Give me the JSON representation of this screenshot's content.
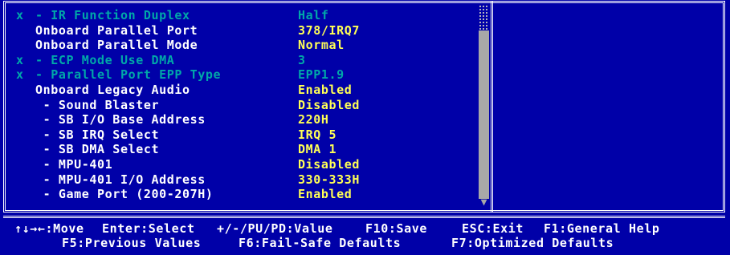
{
  "menu_rows": [
    {
      "marker": "x",
      "label": "- IR Function Duplex",
      "value": "Half",
      "disabled": true
    },
    {
      "marker": "",
      "label": "Onboard Parallel Port",
      "value": "378/IRQ7",
      "disabled": false
    },
    {
      "marker": "",
      "label": "Onboard Parallel Mode",
      "value": "Normal",
      "disabled": false
    },
    {
      "marker": "x",
      "label": "- ECP Mode Use DMA",
      "value": "3",
      "disabled": true
    },
    {
      "marker": "x",
      "label": "- Parallel Port EPP Type",
      "value": "EPP1.9",
      "disabled": true
    },
    {
      "marker": "",
      "label": "Onboard Legacy Audio",
      "value": "Enabled",
      "disabled": false
    },
    {
      "marker": "",
      "label": " - Sound Blaster",
      "value": "Disabled",
      "disabled": false
    },
    {
      "marker": "",
      "label": " - SB I/O Base Address",
      "value": "220H",
      "disabled": false
    },
    {
      "marker": "",
      "label": " - SB IRQ Select",
      "value": "IRQ 5",
      "disabled": false
    },
    {
      "marker": "",
      "label": " - SB DMA Select",
      "value": "DMA 1",
      "disabled": false
    },
    {
      "marker": "",
      "label": " - MPU-401",
      "value": "Disabled",
      "disabled": false
    },
    {
      "marker": "",
      "label": " - MPU-401 I/O Address",
      "value": "330-333H",
      "disabled": false
    },
    {
      "marker": "",
      "label": " - Game Port (200-207H)",
      "value": "Enabled",
      "disabled": false
    }
  ],
  "scrollbar": {
    "down_arrow": "▼"
  },
  "footer": {
    "line1": [
      "↑↓→←:Move",
      "Enter:Select",
      "+/-/PU/PD:Value",
      "F10:Save",
      "ESC:Exit",
      "F1:General Help"
    ],
    "line2": [
      "F5:Previous Values",
      "F6:Fail-Safe Defaults",
      "F7:Optimized Defaults"
    ]
  },
  "colors": {
    "background": "#0000a8",
    "label": "#ffffff",
    "value": "#ffff55",
    "disabled": "#00a8a8"
  }
}
